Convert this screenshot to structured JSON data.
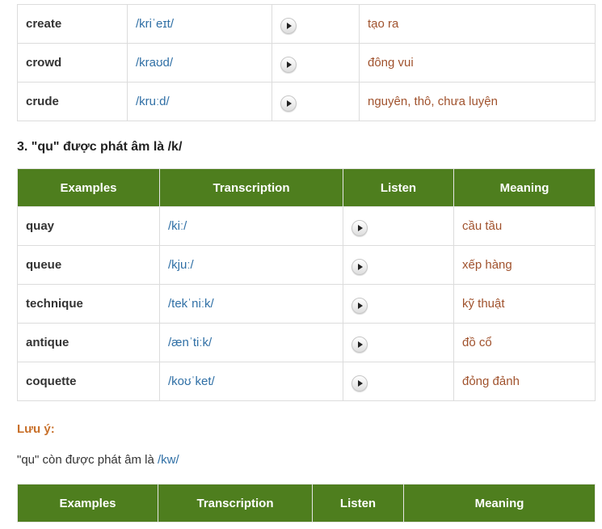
{
  "table1": {
    "rows": [
      {
        "word": "create",
        "ipa": "/kriˈeɪt/",
        "meaning": "tạo ra"
      },
      {
        "word": "crowd",
        "ipa": "/kraʊd/",
        "meaning": "đông vui"
      },
      {
        "word": "crude",
        "ipa": "/kruːd/",
        "meaning": "nguyên, thô, chưa luyện"
      }
    ]
  },
  "section3": {
    "heading": "3. \"qu\" được phát âm là /k/"
  },
  "table2": {
    "headers": [
      "Examples",
      "Transcription",
      "Listen",
      "Meaning"
    ],
    "rows": [
      {
        "word": "quay",
        "ipa": "/kiː/",
        "meaning": "cầu tầu"
      },
      {
        "word": "queue",
        "ipa": "/kjuː/",
        "meaning": "xếp hàng"
      },
      {
        "word": "technique",
        "ipa": "/tekˈniːk/",
        "meaning": "kỹ thuật"
      },
      {
        "word": "antique",
        "ipa": "/ænˈtiːk/",
        "meaning": "đồ cổ"
      },
      {
        "word": "coquette",
        "ipa": "/koʊˈket/",
        "meaning": "đỏng đảnh"
      }
    ]
  },
  "note": {
    "title": "Lưu ý:",
    "text": "\"qu\" còn được phát âm là ",
    "ipa": "/kw/"
  },
  "table3": {
    "headers": [
      "Examples",
      "Transcription",
      "Listen",
      "Meaning"
    ]
  },
  "icons": {
    "listen": "play-icon"
  },
  "colors": {
    "header_bg": "#4e7e1e",
    "ipa": "#2f6fa5",
    "meaning": "#a0522d",
    "note_title": "#c8702a"
  }
}
